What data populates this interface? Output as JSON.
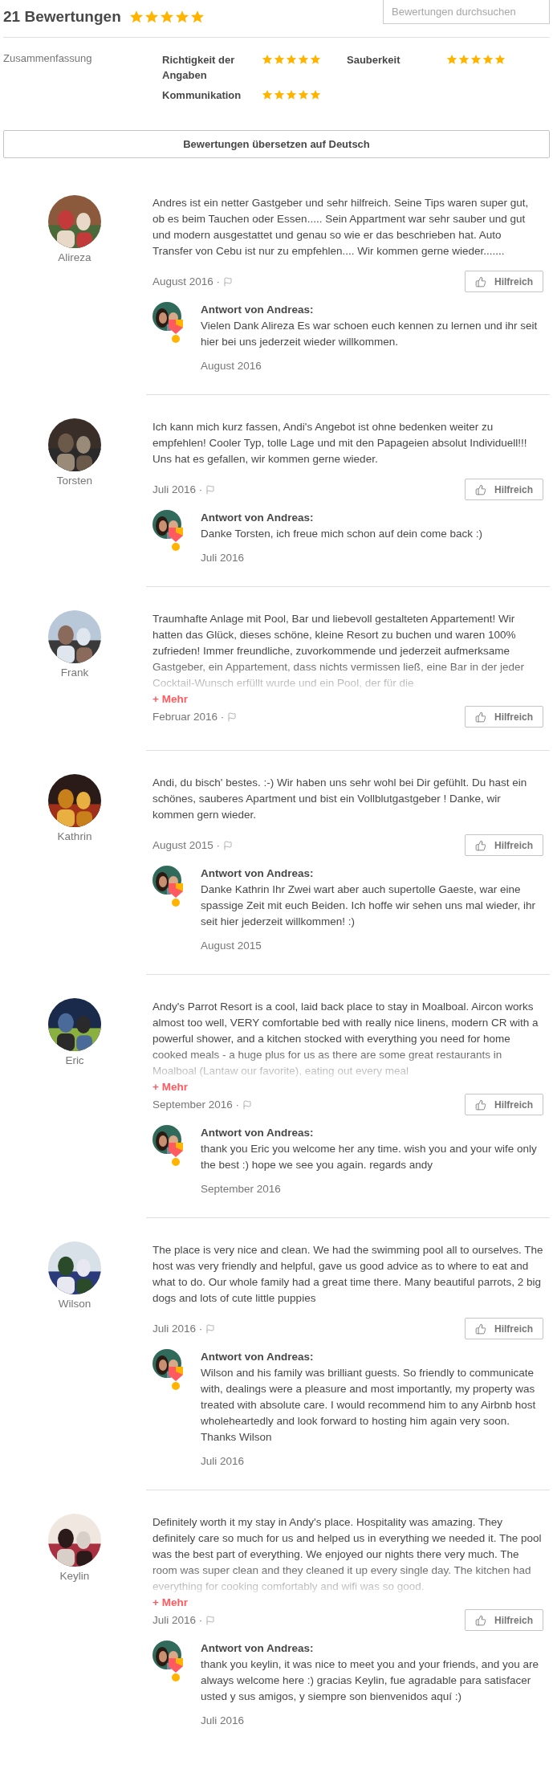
{
  "header": {
    "title": "21 Bewertungen",
    "stars": 5,
    "search": {
      "placeholder": "Bewertungen durchsuchen"
    }
  },
  "summary": {
    "label": "Zusammenfassung",
    "ratings": [
      {
        "name": "Richtigkeit der Angaben",
        "stars": 5
      },
      {
        "name": "Sauberkeit",
        "stars": 5
      },
      {
        "name": "Kommunikation",
        "stars": 5
      }
    ]
  },
  "translate_button": "Bewertungen übersetzen auf Deutsch",
  "reviews": [
    {
      "author": "Alireza",
      "text": "Andres ist ein netter Gastgeber und sehr hilfreich. Seine Tips waren super gut, ob es beim Tauchen oder Essen..... Sein Appartment war sehr sauber und gut und modern ausgestattet und genau so wie er das beschrieben hat. Auto Transfer von Cebu ist nur zu empfehlen.... Wir kommen gerne wieder.......",
      "truncated": false,
      "date": "August 2016 ·",
      "helpful_button": "Hilfreich",
      "response": {
        "title": "Antwort von Andreas:",
        "text": "Vielen Dank Alireza Es war schoen euch kennen zu lernen und ihr seit hier bei uns jederzeit wieder willkommen.",
        "date": "August 2016"
      }
    },
    {
      "author": "Torsten",
      "text": "Ich kann mich kurz fassen, Andi's Angebot ist ohne bedenken weiter zu empfehlen! Cooler Typ, tolle Lage und mit den Papageien absolut Individuell!!! Uns hat es gefallen, wir kommen gerne wieder.",
      "truncated": false,
      "date": "Juli 2016 ·",
      "helpful_button": "Hilfreich",
      "response": {
        "title": "Antwort von Andreas:",
        "text": "Danke Torsten, ich freue mich schon auf dein come back :)",
        "date": "Juli 2016"
      }
    },
    {
      "author": "Frank",
      "text": "Traumhafte Anlage mit Pool, Bar und liebevoll gestalteten Appartement! Wir hatten das Glück, dieses schöne, kleine Resort zu buchen und waren 100% zufrieden! Immer freundliche, zuvorkommende und jederzeit aufmerksame Gastgeber, ein Appartement, dass nichts vermissen ließ, eine Bar in der jeder Cocktail-Wunsch erfüllt wurde und ein Pool, der für die",
      "truncated": true,
      "more_link": "+ Mehr",
      "date": "Februar 2016 ·",
      "helpful_button": "Hilfreich"
    },
    {
      "author": "Kathrin",
      "text": "Andi, du bisch' bestes. :-) Wir haben uns sehr wohl bei Dir gefühlt. Du hast ein schönes, sauberes Apartment und bist ein Vollblutgastgeber ! Danke, wir kommen gern wieder.",
      "truncated": false,
      "date": "August 2015 ·",
      "helpful_button": "Hilfreich",
      "response": {
        "title": "Antwort von Andreas:",
        "text": "Danke Kathrin Ihr Zwei wart aber auch supertolle Gaeste, war eine spassige Zeit mit euch Beiden. Ich hoffe wir sehen uns mal wieder, ihr seit hier jederzeit willkommen! :)",
        "date": "August 2015"
      }
    },
    {
      "author": "Eric",
      "text": "Andy's Parrot Resort is a cool, laid back place to stay in Moalboal. Aircon works almost too well, VERY comfortable bed with really nice linens, modern CR with a powerful shower, and a kitchen stocked with everything you need for home cooked meals - a huge plus for us as there are some great restaurants in Moalboal (Lantaw our favorite), eating out every meal",
      "truncated": true,
      "more_link": "+ Mehr",
      "date": "September 2016 ·",
      "helpful_button": "Hilfreich",
      "response": {
        "title": "Antwort von Andreas:",
        "text": "thank you Eric you welcome her any time. wish you and your wife only the best :) hope we see you again. regards andy",
        "date": "September 2016"
      }
    },
    {
      "author": "Wilson",
      "text": "The place is very nice and clean. We had the swimming pool all to ourselves. The host was very friendly and helpful, gave us good advice as to where to eat and what to do. Our whole family had a great time there. Many beautiful parrots, 2 big dogs and lots of cute little puppies",
      "truncated": false,
      "date": "Juli 2016 ·",
      "helpful_button": "Hilfreich",
      "response": {
        "title": "Antwort von Andreas:",
        "text": "Wilson and his family was brilliant guests. So friendly to communicate with, dealings were a pleasure and most importantly, my property was treated with absolute care. I would recommend him to any Airbnb host wholeheartedly and look forward to hosting him again very soon. Thanks Wilson",
        "date": "Juli 2016"
      }
    },
    {
      "author": "Keylin",
      "text": "Definitely worth it my stay in Andy's place. Hospitality was amazing. They definitely care so much for us and helped us in everything we needed it. The pool was the best part of everything. We enjoyed our nights there very much. The room was super clean and they cleaned it up every single day. The kitchen had everything for cooking comfortably and wifi was so good.",
      "truncated": true,
      "more_link": "+ Mehr",
      "date": "Juli 2016 ·",
      "helpful_button": "Hilfreich",
      "response": {
        "title": "Antwort von Andreas:",
        "text": "thank you keylin, it was nice to meet you and your friends, and you are always welcome here :) gracias Keylin, fue agradable para satisfacer usted y sus amigos, y siempre son bienvenidos aquí :)",
        "date": "Juli 2016"
      }
    }
  ]
}
